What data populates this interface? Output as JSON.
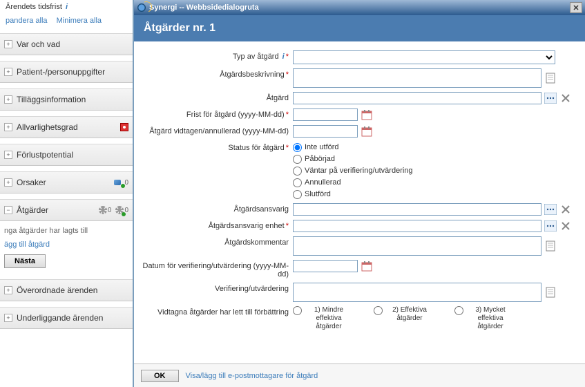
{
  "left": {
    "deadline_label": "Ärendets tidsfrist",
    "expand_all": "pandera alla",
    "collapse_all": "Minimera alla",
    "sections": [
      {
        "label": "Var och vad"
      },
      {
        "label": "Patient-/personuppgifter"
      },
      {
        "label": "Tilläggsinformation"
      },
      {
        "label": "Allvarlighetsgrad"
      },
      {
        "label": "Förlustpotential"
      },
      {
        "label": "Orsaker"
      },
      {
        "label": "Åtgärder"
      },
      {
        "label": "Överordnade ärenden"
      },
      {
        "label": "Underliggande ärenden"
      }
    ],
    "counts": {
      "orsaker": "0",
      "atgarder1": "0",
      "atgarder2": "0"
    },
    "no_actions": "nga åtgärder har lagts till",
    "add_action": "ägg till åtgärd",
    "next": "Nästa"
  },
  "dialog": {
    "window_title": "Synergi -- Webbsidedialogruta",
    "header": "Åtgärder nr. 1",
    "labels": {
      "type": "Typ av åtgärd",
      "desc": "Åtgärdsbeskrivning",
      "action": "Åtgärd",
      "deadline": "Frist för åtgärd (yyyy-MM-dd)",
      "done_date": "Åtgärd vidtagen/annullerad (yyyy-MM-dd)",
      "status": "Status för åtgärd",
      "responsible": "Åtgärdsansvarig",
      "resp_unit": "Åtgärdsansvarig enhet",
      "comment": "Åtgärdskommentar",
      "verify_date": "Datum för verifiering/utvärdering (yyyy-MM-dd)",
      "verify": "Verifiering/utvärdering",
      "improvement": "Vidtagna åtgärder har lett till förbättring"
    },
    "status_opts": [
      "Inte utförd",
      "Påbörjad",
      "Väntar på verifiering/utvärdering",
      "Annullerad",
      "Slutförd"
    ],
    "rating_opts": [
      "1) Mindre effektiva åtgärder",
      "2) Effektiva åtgärder",
      "3) Mycket effektiva åtgärder"
    ],
    "footer_link": "Visa/lägg till e-postmottagare för åtgärd",
    "ok": "OK"
  }
}
